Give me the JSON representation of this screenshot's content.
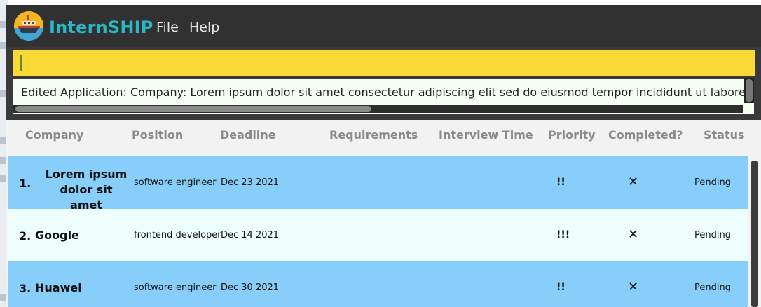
{
  "app": {
    "title": "InternSHIP",
    "menu": {
      "file": "File",
      "help": "Help"
    }
  },
  "command": {
    "value": "",
    "placeholder": ""
  },
  "result": {
    "text": "Edited Application: Company: Lorem ipsum dolor sit amet consectetur adipiscing elit sed do eiusmod tempor incididunt ut labore et d"
  },
  "columns": {
    "company": "Company",
    "position": "Position",
    "deadline": "Deadline",
    "requirements": "Requirements",
    "interview_time": "Interview Time",
    "priority": "Priority",
    "completed": "Completed?",
    "status": "Status"
  },
  "applications": [
    {
      "index": "1.",
      "company_line1": "Lorem ipsum",
      "company_line2": "dolor sit amet",
      "position": "software engineer",
      "deadline": "Dec 23 2021",
      "requirements": "",
      "interview_time": "",
      "priority": "!!",
      "completed": "✕",
      "status": "Pending"
    },
    {
      "index": "2.",
      "company_line1": "Google",
      "company_line2": "",
      "position": "frontend developer",
      "deadline": "Dec 14 2021",
      "requirements": "",
      "interview_time": "",
      "priority": "!!!",
      "completed": "✕",
      "status": "Pending"
    },
    {
      "index": "3.",
      "company_line1": "Huawei",
      "company_line2": "",
      "position": "software engineer",
      "deadline": "Dec 30 2021",
      "requirements": "",
      "interview_time": "",
      "priority": "!!",
      "completed": "✕",
      "status": "Pending"
    }
  ],
  "icons": {
    "logo": "ship-logo-icon",
    "completed": "cross-icon"
  },
  "colors": {
    "title_accent": "#2ab7c7",
    "command_bg": "#fbd937",
    "row_odd": "#87cefa",
    "row_even": "#eefffe",
    "result_bg": "#f6fff4"
  }
}
